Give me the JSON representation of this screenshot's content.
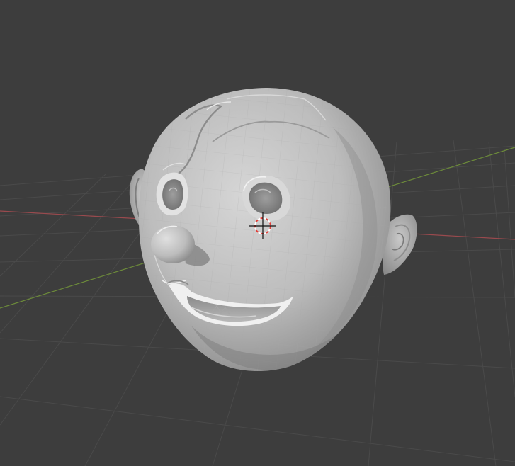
{
  "viewport": {
    "mode": "sculpt",
    "background_color": "#3d3d3d",
    "grid_color": "#4a4a4a",
    "x_axis_color": "#9a4a4e",
    "y_axis_color": "#6c8a3a",
    "mesh_color": "#c2c2c2",
    "cursor_color": "#e0403a",
    "object": "sculpted-head"
  }
}
